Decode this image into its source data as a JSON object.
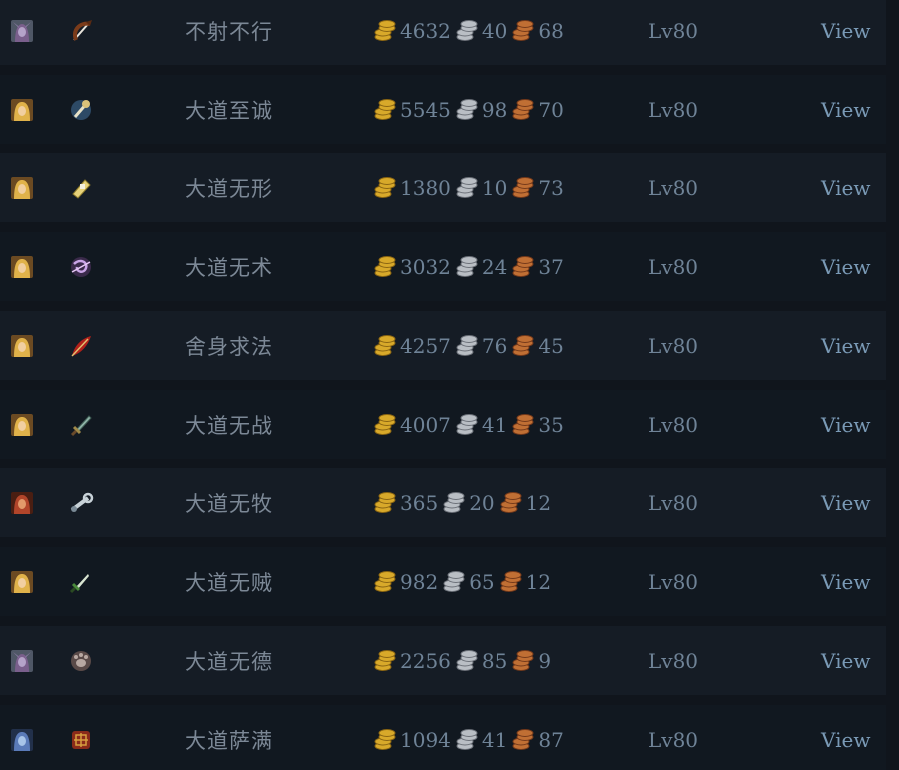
{
  "colors": {
    "gold": "#d8a92a",
    "silver": "#b9bec4",
    "copper": "#c06f34"
  },
  "rows": [
    {
      "race_icon": "night-elf-portrait-icon",
      "class_icon": "bow-icon",
      "name": "不射不行",
      "gold": "4632",
      "silver": "40",
      "copper": "68",
      "level": "Lv80",
      "action": "View"
    },
    {
      "race_icon": "human-portrait-icon",
      "class_icon": "holy-mace-icon",
      "name": "大道至诚",
      "gold": "5545",
      "silver": "98",
      "copper": "70",
      "level": "Lv80",
      "action": "View"
    },
    {
      "race_icon": "human-portrait-icon",
      "class_icon": "priest-scroll-icon",
      "name": "大道无形",
      "gold": "1380",
      "silver": "10",
      "copper": "73",
      "level": "Lv80",
      "action": "View"
    },
    {
      "race_icon": "human-portrait-icon",
      "class_icon": "arcane-swirl-icon",
      "name": "大道无术",
      "gold": "3032",
      "silver": "24",
      "copper": "37",
      "level": "Lv80",
      "action": "View"
    },
    {
      "race_icon": "human-portrait-icon",
      "class_icon": "red-feather-icon",
      "name": "舍身求法",
      "gold": "4257",
      "silver": "76",
      "copper": "45",
      "level": "Lv80",
      "action": "View"
    },
    {
      "race_icon": "human-portrait-icon",
      "class_icon": "sword-icon",
      "name": "大道无战",
      "gold": "4007",
      "silver": "41",
      "copper": "35",
      "level": "Lv80",
      "action": "View"
    },
    {
      "race_icon": "orc-portrait-icon",
      "class_icon": "wrench-icon",
      "name": "大道无牧",
      "gold": "365",
      "silver": "20",
      "copper": "12",
      "level": "Lv80",
      "action": "View"
    },
    {
      "race_icon": "human-portrait-icon",
      "class_icon": "dagger-icon",
      "name": "大道无贼",
      "gold": "982",
      "silver": "65",
      "copper": "12",
      "level": "Lv80",
      "action": "View"
    },
    {
      "race_icon": "night-elf-portrait-icon",
      "class_icon": "paw-icon",
      "name": "大道无德",
      "gold": "2256",
      "silver": "85",
      "copper": "9",
      "level": "Lv80",
      "action": "View"
    },
    {
      "race_icon": "draenei-portrait-icon",
      "class_icon": "totem-icon",
      "name": "大道萨满",
      "gold": "1094",
      "silver": "41",
      "copper": "87",
      "level": "Lv80",
      "action": "View"
    }
  ]
}
